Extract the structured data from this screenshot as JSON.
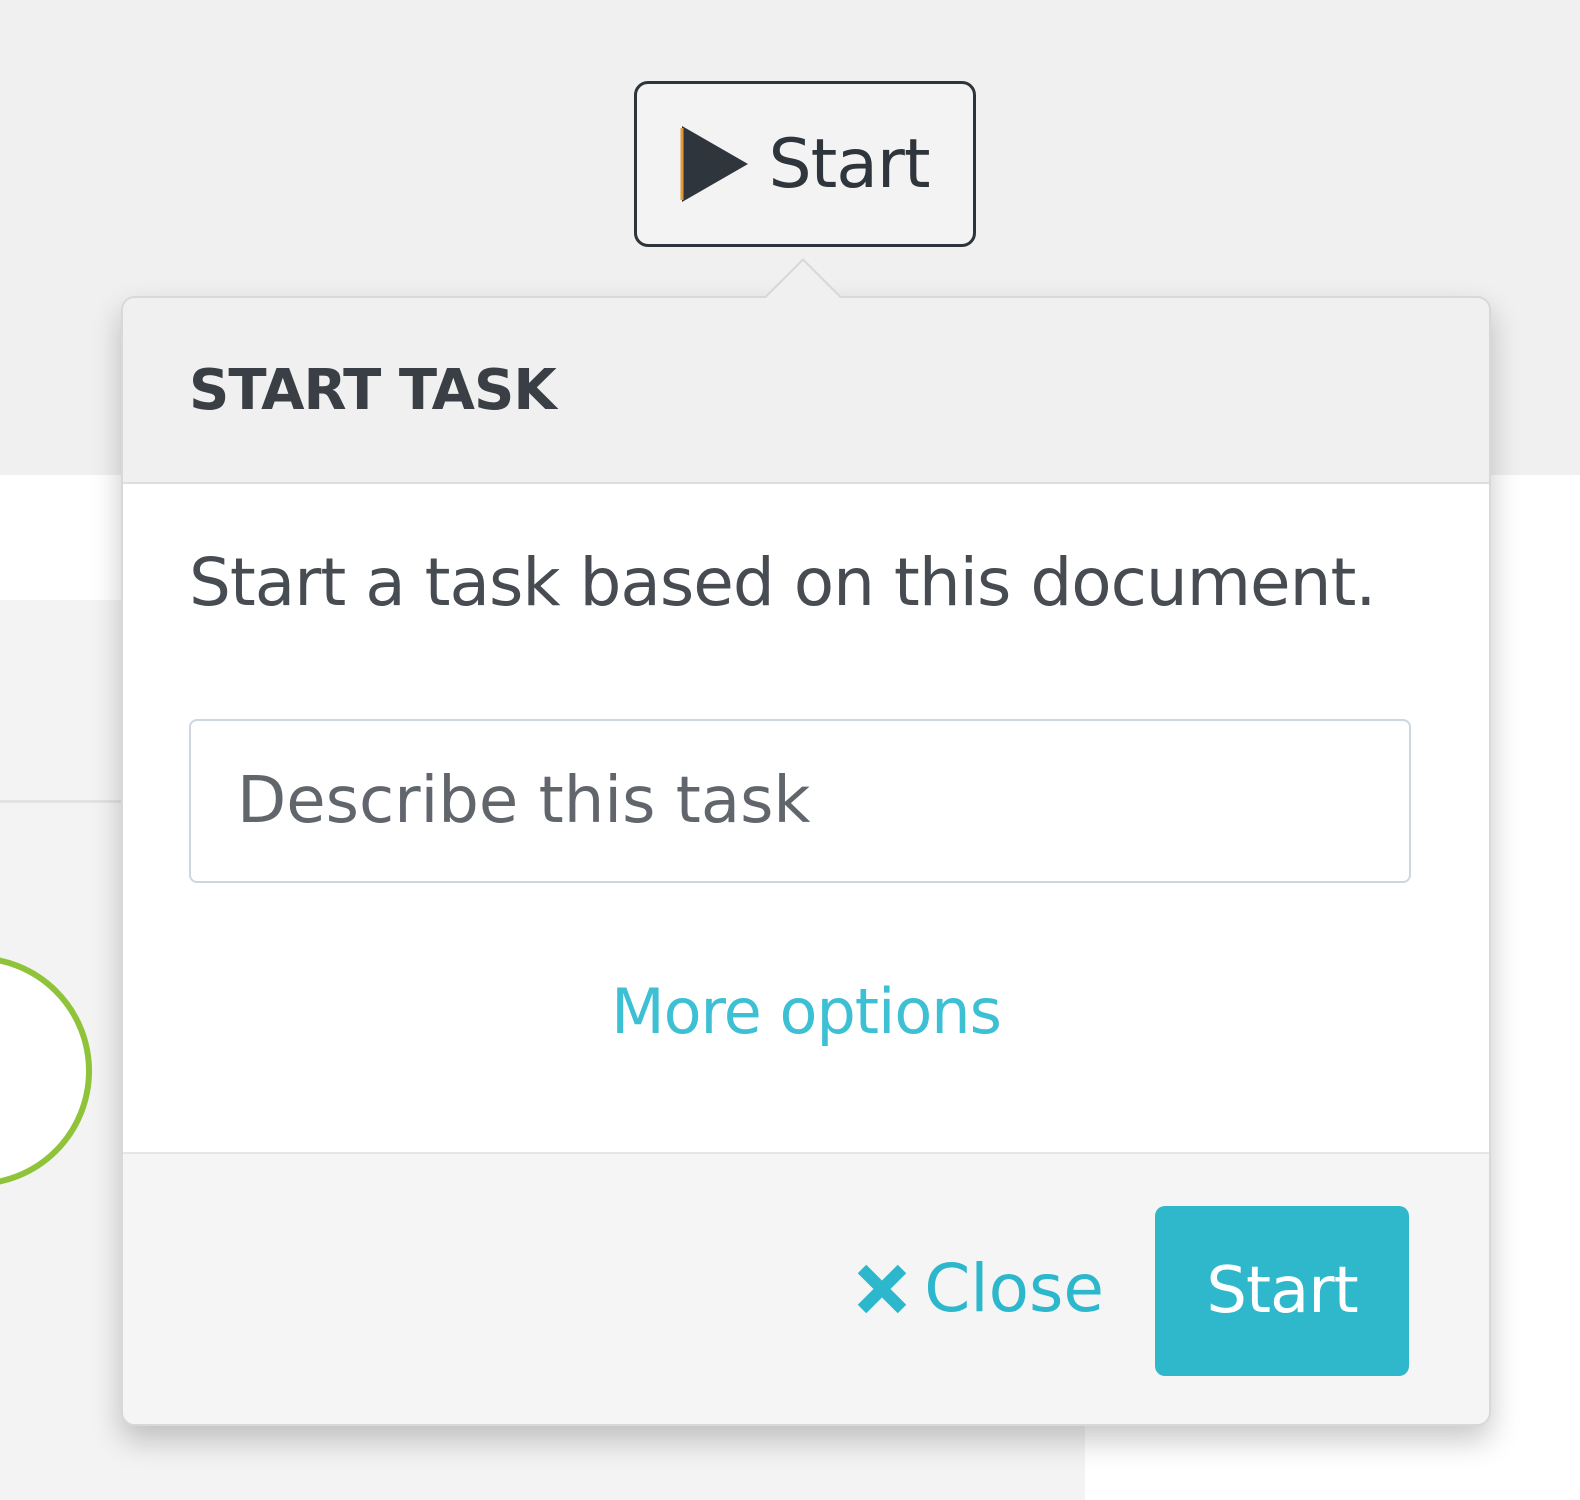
{
  "toolbar": {
    "start_label": "Start",
    "start_icon": "play-icon"
  },
  "popover": {
    "title": "START TASK",
    "description": "Start a task based on this document.",
    "input": {
      "placeholder": "Describe this task",
      "value": ""
    },
    "more_options_label": "More options",
    "close_label": "Close",
    "close_icon": "close-icon",
    "submit_label": "Start"
  },
  "colors": {
    "accent": "#2fb7cc",
    "link": "#3ec0d4",
    "status_circle": "#8fc43a"
  }
}
